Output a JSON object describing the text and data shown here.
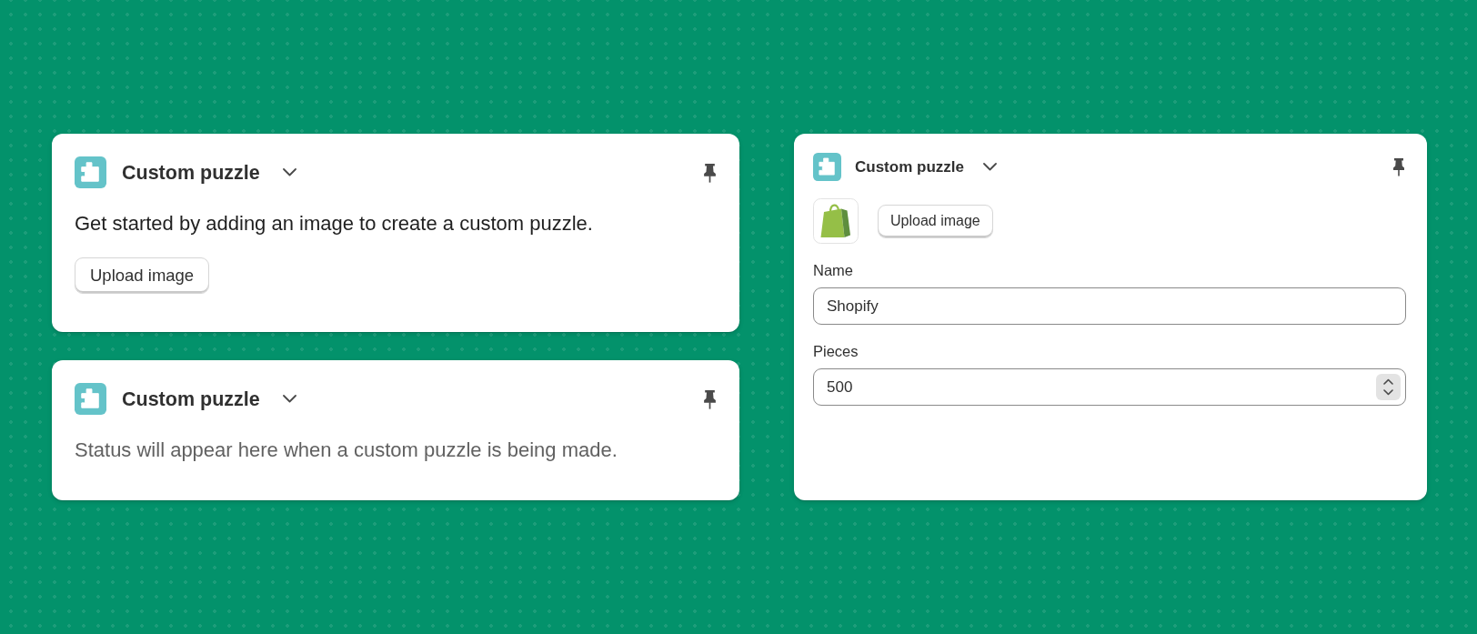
{
  "columns": [
    {
      "cards": [
        {
          "kind": "intro",
          "title": "Custom puzzle",
          "text": "Get started by adding an image to create a custom puzzle.",
          "button": "Upload image"
        },
        {
          "kind": "status",
          "title": "Custom puzzle",
          "text": "Status will appear here when a custom puzzle is being made."
        }
      ]
    },
    {
      "cards": [
        {
          "kind": "form",
          "title": "Custom puzzle",
          "button": "Upload image",
          "fields": [
            {
              "kind": "text",
              "label": "Name",
              "value": "Shopify"
            },
            {
              "kind": "number",
              "label": "Pieces",
              "value": "500"
            }
          ]
        }
      ]
    }
  ]
}
